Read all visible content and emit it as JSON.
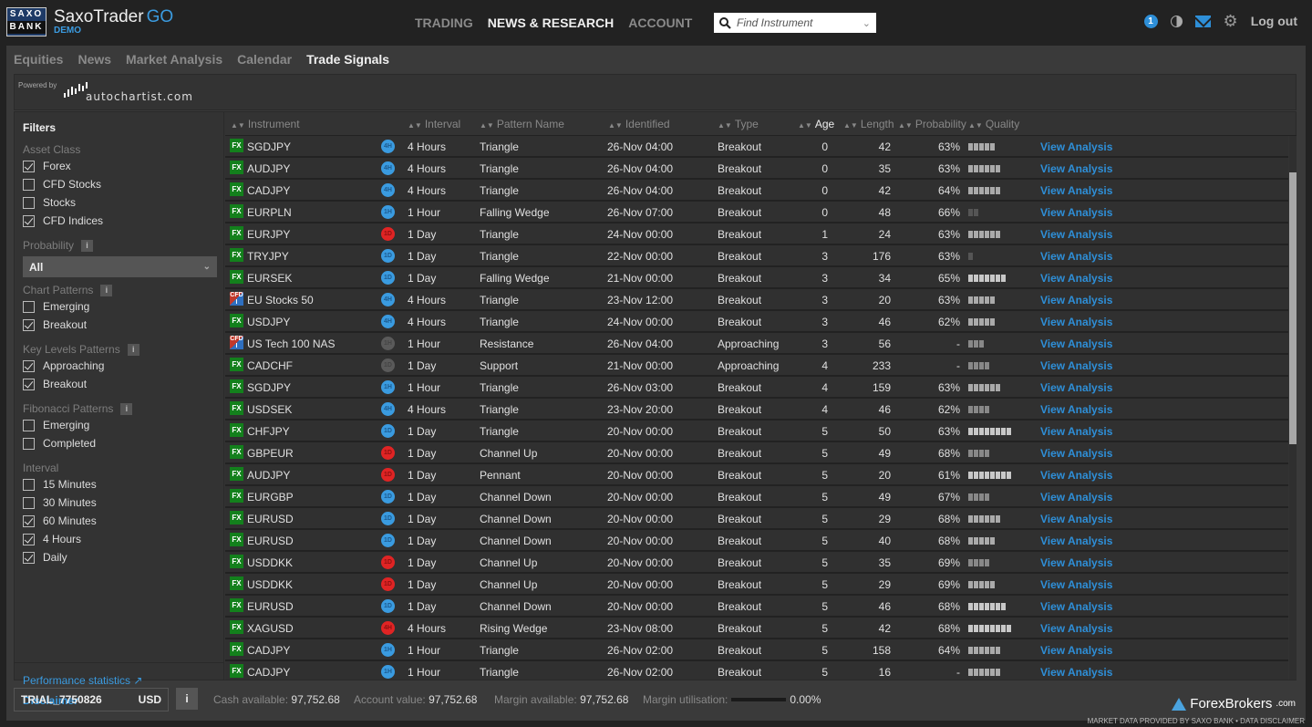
{
  "header": {
    "logo_line1": "SAXO",
    "logo_line2": "BANK",
    "app_name": "SaxoTrader",
    "app_suffix": "GO",
    "env_label": "DEMO",
    "nav": [
      {
        "label": "TRADING",
        "active": false
      },
      {
        "label": "NEWS & RESEARCH",
        "active": true
      },
      {
        "label": "ACCOUNT",
        "active": false
      }
    ],
    "search_placeholder": "Find Instrument",
    "notification_count": "1",
    "logout_label": "Log out"
  },
  "subnav": [
    {
      "label": "Equities",
      "active": false
    },
    {
      "label": "News",
      "active": false
    },
    {
      "label": "Market Analysis",
      "active": false
    },
    {
      "label": "Calendar",
      "active": false
    },
    {
      "label": "Trade Signals",
      "active": true
    }
  ],
  "powered": {
    "prefix": "Powered by",
    "brand": "autochartist.com"
  },
  "filters": {
    "title": "Filters",
    "asset_class": {
      "label": "Asset Class",
      "options": [
        {
          "label": "Forex",
          "checked": true
        },
        {
          "label": "CFD Stocks",
          "checked": false
        },
        {
          "label": "Stocks",
          "checked": false
        },
        {
          "label": "CFD Indices",
          "checked": true
        }
      ]
    },
    "probability": {
      "label": "Probability",
      "selected": "All"
    },
    "chart_patterns": {
      "label": "Chart Patterns",
      "options": [
        {
          "label": "Emerging",
          "checked": false
        },
        {
          "label": "Breakout",
          "checked": true
        }
      ]
    },
    "key_levels": {
      "label": "Key Levels Patterns",
      "options": [
        {
          "label": "Approaching",
          "checked": true
        },
        {
          "label": "Breakout",
          "checked": true
        }
      ]
    },
    "fibonacci": {
      "label": "Fibonacci Patterns",
      "options": [
        {
          "label": "Emerging",
          "checked": false
        },
        {
          "label": "Completed",
          "checked": false
        }
      ]
    },
    "interval": {
      "label": "Interval",
      "options": [
        {
          "label": "15 Minutes",
          "checked": false
        },
        {
          "label": "30 Minutes",
          "checked": false
        },
        {
          "label": "60 Minutes",
          "checked": true
        },
        {
          "label": "4 Hours",
          "checked": true
        },
        {
          "label": "Daily",
          "checked": true
        }
      ]
    },
    "performance_link": "Performance statistics",
    "disclaimer_link": "Disclaimer"
  },
  "table": {
    "columns": [
      "Instrument",
      "Interval",
      "Pattern Name",
      "Identified",
      "Type",
      "Age",
      "Length",
      "Probability",
      "Quality"
    ],
    "sorted_column": "Age",
    "action_label": "View Analysis",
    "rows": [
      {
        "asset": "FX",
        "instrument": "SGDJPY",
        "iv_badge": "4H",
        "iv_color": "blue",
        "interval": "4 Hours",
        "pattern": "Triangle",
        "identified": "26-Nov 04:00",
        "type": "Breakout",
        "age": "0",
        "length": "42",
        "probability": "63%",
        "quality": 5
      },
      {
        "asset": "FX",
        "instrument": "AUDJPY",
        "iv_badge": "4H",
        "iv_color": "blue",
        "interval": "4 Hours",
        "pattern": "Triangle",
        "identified": "26-Nov 04:00",
        "type": "Breakout",
        "age": "0",
        "length": "35",
        "probability": "63%",
        "quality": 6
      },
      {
        "asset": "FX",
        "instrument": "CADJPY",
        "iv_badge": "4H",
        "iv_color": "blue",
        "interval": "4 Hours",
        "pattern": "Triangle",
        "identified": "26-Nov 04:00",
        "type": "Breakout",
        "age": "0",
        "length": "42",
        "probability": "64%",
        "quality": 6
      },
      {
        "asset": "FX",
        "instrument": "EURPLN",
        "iv_badge": "1H",
        "iv_color": "blue",
        "interval": "1 Hour",
        "pattern": "Falling Wedge",
        "identified": "26-Nov 07:00",
        "type": "Breakout",
        "age": "0",
        "length": "48",
        "probability": "66%",
        "quality": 2
      },
      {
        "asset": "FX",
        "instrument": "EURJPY",
        "iv_badge": "1D",
        "iv_color": "red",
        "interval": "1 Day",
        "pattern": "Triangle",
        "identified": "24-Nov 00:00",
        "type": "Breakout",
        "age": "1",
        "length": "24",
        "probability": "63%",
        "quality": 6
      },
      {
        "asset": "FX",
        "instrument": "TRYJPY",
        "iv_badge": "1D",
        "iv_color": "blue",
        "interval": "1 Day",
        "pattern": "Triangle",
        "identified": "22-Nov 00:00",
        "type": "Breakout",
        "age": "3",
        "length": "176",
        "probability": "63%",
        "quality": 1
      },
      {
        "asset": "FX",
        "instrument": "EURSEK",
        "iv_badge": "1D",
        "iv_color": "blue",
        "interval": "1 Day",
        "pattern": "Falling Wedge",
        "identified": "21-Nov 00:00",
        "type": "Breakout",
        "age": "3",
        "length": "34",
        "probability": "65%",
        "quality": 7
      },
      {
        "asset": "CFD",
        "instrument": "EU Stocks 50",
        "iv_badge": "4H",
        "iv_color": "blue",
        "interval": "4 Hours",
        "pattern": "Triangle",
        "identified": "23-Nov 12:00",
        "type": "Breakout",
        "age": "3",
        "length": "20",
        "probability": "63%",
        "quality": 5
      },
      {
        "asset": "FX",
        "instrument": "USDJPY",
        "iv_badge": "4H",
        "iv_color": "blue",
        "interval": "4 Hours",
        "pattern": "Triangle",
        "identified": "24-Nov 00:00",
        "type": "Breakout",
        "age": "3",
        "length": "46",
        "probability": "62%",
        "quality": 5
      },
      {
        "asset": "CFD",
        "instrument": "US Tech 100 NAS",
        "iv_badge": "1H",
        "iv_color": "grey",
        "interval": "1 Hour",
        "pattern": "Resistance",
        "identified": "26-Nov 04:00",
        "type": "Approaching",
        "age": "3",
        "length": "56",
        "probability": "-",
        "quality": 3
      },
      {
        "asset": "FX",
        "instrument": "CADCHF",
        "iv_badge": "1D",
        "iv_color": "grey",
        "interval": "1 Day",
        "pattern": "Support",
        "identified": "21-Nov 00:00",
        "type": "Approaching",
        "age": "4",
        "length": "233",
        "probability": "-",
        "quality": 4
      },
      {
        "asset": "FX",
        "instrument": "SGDJPY",
        "iv_badge": "1H",
        "iv_color": "blue",
        "interval": "1 Hour",
        "pattern": "Triangle",
        "identified": "26-Nov 03:00",
        "type": "Breakout",
        "age": "4",
        "length": "159",
        "probability": "63%",
        "quality": 6
      },
      {
        "asset": "FX",
        "instrument": "USDSEK",
        "iv_badge": "4H",
        "iv_color": "blue",
        "interval": "4 Hours",
        "pattern": "Triangle",
        "identified": "23-Nov 20:00",
        "type": "Breakout",
        "age": "4",
        "length": "46",
        "probability": "62%",
        "quality": 4
      },
      {
        "asset": "FX",
        "instrument": "CHFJPY",
        "iv_badge": "1D",
        "iv_color": "blue",
        "interval": "1 Day",
        "pattern": "Triangle",
        "identified": "20-Nov 00:00",
        "type": "Breakout",
        "age": "5",
        "length": "50",
        "probability": "63%",
        "quality": 8
      },
      {
        "asset": "FX",
        "instrument": "GBPEUR",
        "iv_badge": "1D",
        "iv_color": "red",
        "interval": "1 Day",
        "pattern": "Channel Up",
        "identified": "20-Nov 00:00",
        "type": "Breakout",
        "age": "5",
        "length": "49",
        "probability": "68%",
        "quality": 4
      },
      {
        "asset": "FX",
        "instrument": "AUDJPY",
        "iv_badge": "1D",
        "iv_color": "red",
        "interval": "1 Day",
        "pattern": "Pennant",
        "identified": "20-Nov 00:00",
        "type": "Breakout",
        "age": "5",
        "length": "20",
        "probability": "61%",
        "quality": 8
      },
      {
        "asset": "FX",
        "instrument": "EURGBP",
        "iv_badge": "1D",
        "iv_color": "blue",
        "interval": "1 Day",
        "pattern": "Channel Down",
        "identified": "20-Nov 00:00",
        "type": "Breakout",
        "age": "5",
        "length": "49",
        "probability": "67%",
        "quality": 4
      },
      {
        "asset": "FX",
        "instrument": "EURUSD",
        "iv_badge": "1D",
        "iv_color": "blue",
        "interval": "1 Day",
        "pattern": "Channel Down",
        "identified": "20-Nov 00:00",
        "type": "Breakout",
        "age": "5",
        "length": "29",
        "probability": "68%",
        "quality": 6
      },
      {
        "asset": "FX",
        "instrument": "EURUSD",
        "iv_badge": "1D",
        "iv_color": "blue",
        "interval": "1 Day",
        "pattern": "Channel Down",
        "identified": "20-Nov 00:00",
        "type": "Breakout",
        "age": "5",
        "length": "40",
        "probability": "68%",
        "quality": 5
      },
      {
        "asset": "FX",
        "instrument": "USDDKK",
        "iv_badge": "1D",
        "iv_color": "red",
        "interval": "1 Day",
        "pattern": "Channel Up",
        "identified": "20-Nov 00:00",
        "type": "Breakout",
        "age": "5",
        "length": "35",
        "probability": "69%",
        "quality": 4
      },
      {
        "asset": "FX",
        "instrument": "USDDKK",
        "iv_badge": "1D",
        "iv_color": "red",
        "interval": "1 Day",
        "pattern": "Channel Up",
        "identified": "20-Nov 00:00",
        "type": "Breakout",
        "age": "5",
        "length": "29",
        "probability": "69%",
        "quality": 5
      },
      {
        "asset": "FX",
        "instrument": "EURUSD",
        "iv_badge": "1D",
        "iv_color": "blue",
        "interval": "1 Day",
        "pattern": "Channel Down",
        "identified": "20-Nov 00:00",
        "type": "Breakout",
        "age": "5",
        "length": "46",
        "probability": "68%",
        "quality": 7
      },
      {
        "asset": "FX",
        "instrument": "XAGUSD",
        "iv_badge": "4H",
        "iv_color": "red",
        "interval": "4 Hours",
        "pattern": "Rising Wedge",
        "identified": "23-Nov 08:00",
        "type": "Breakout",
        "age": "5",
        "length": "42",
        "probability": "68%",
        "quality": 8
      },
      {
        "asset": "FX",
        "instrument": "CADJPY",
        "iv_badge": "1H",
        "iv_color": "blue",
        "interval": "1 Hour",
        "pattern": "Triangle",
        "identified": "26-Nov 02:00",
        "type": "Breakout",
        "age": "5",
        "length": "158",
        "probability": "64%",
        "quality": 6
      },
      {
        "asset": "FX",
        "instrument": "CADJPY",
        "iv_badge": "1H",
        "iv_color": "blue",
        "interval": "1 Hour",
        "pattern": "Triangle",
        "identified": "26-Nov 02:00",
        "type": "Breakout",
        "age": "5",
        "length": "16",
        "probability": "-",
        "quality": 6
      }
    ]
  },
  "footer": {
    "account_id": "TRIAL_7750826",
    "currency": "USD",
    "info_label": "i",
    "cash_label": "Cash available:",
    "cash_value": "97,752.68",
    "account_label": "Account value:",
    "account_value": "97,752.68",
    "margin_label": "Margin available:",
    "margin_value": "97,752.68",
    "util_label": "Margin utilisation:",
    "util_value": "0.00%",
    "util_fraction": 0.0
  },
  "watermark": {
    "brand": "ForexBrokers",
    "suffix": ".com"
  },
  "market_data_notice": "MARKET DATA PROVIDED BY SAXO BANK • DATA DISCLAIMER"
}
